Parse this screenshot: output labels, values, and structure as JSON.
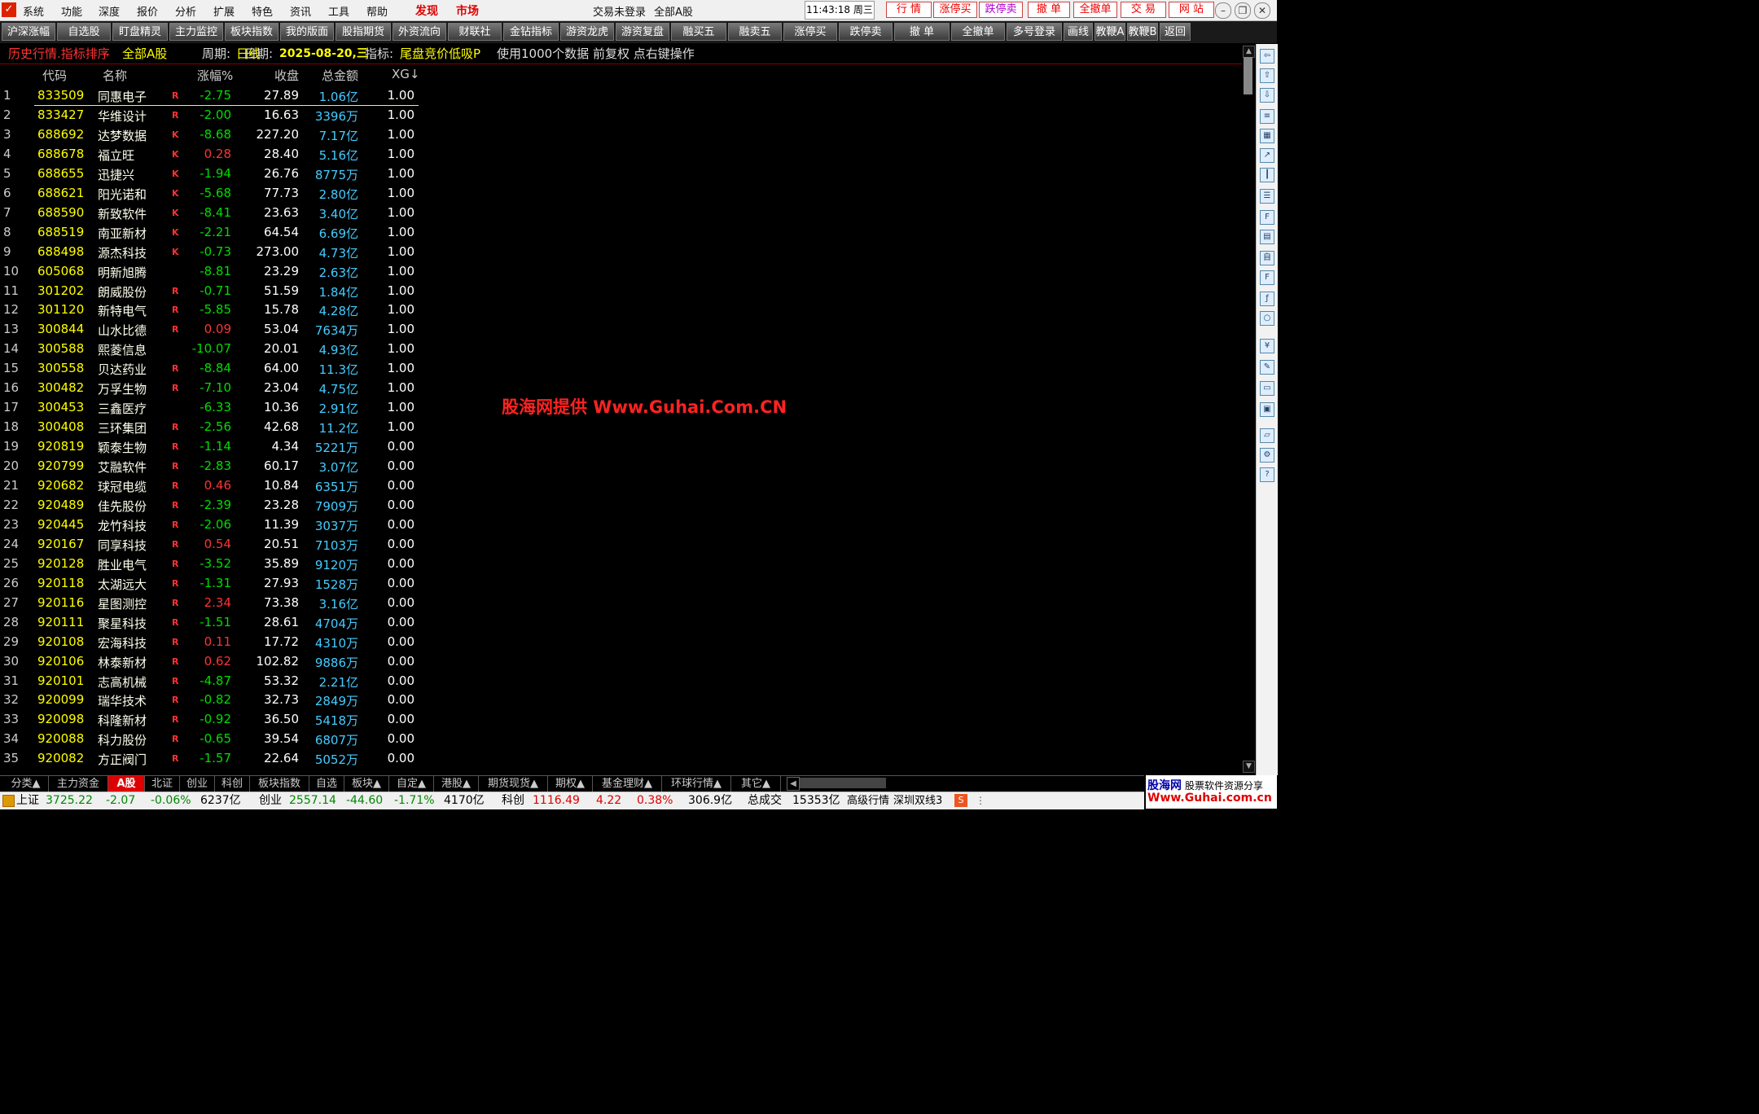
{
  "menu": {
    "items": [
      "系统",
      "功能",
      "深度",
      "报价",
      "分析",
      "扩展",
      "特色",
      "资讯",
      "工具",
      "帮助"
    ],
    "discover": "发现",
    "market": "市场",
    "login_status": "交易未登录",
    "login_scope": "全部A股",
    "clock": "11:43:18 周三",
    "quick_buttons": [
      "行 情",
      "涨停买",
      "跌停卖",
      "撤 单",
      "全撤单",
      "交 易",
      "网 站"
    ]
  },
  "toolbar": {
    "buttons": [
      "沪深涨幅",
      "自选股",
      "盯盘精灵",
      "主力监控",
      "板块指数",
      "我的版面",
      "股指期货",
      "外资流向",
      "财联社",
      "金钻指标",
      "游资龙虎",
      "游资复盘",
      "融买五",
      "融卖五",
      "涨停买",
      "跌停卖",
      "撤 单",
      "全撤单",
      "多号登录",
      "画线",
      "教鞭A",
      "教鞭B",
      "返回"
    ]
  },
  "infobar": {
    "title": "历史行情.指标排序",
    "scope": "全部A股",
    "period_label": "周期:",
    "period": "日线",
    "date_label": "日期:",
    "date": "2025-08-20,三",
    "indicator_label": "指标:",
    "indicator": "尾盘竞价低吸P",
    "note": "使用1000个数据 前复权 点右键操作"
  },
  "table": {
    "columns": [
      "代码",
      "名称",
      "涨幅%",
      "收盘",
      "总金额",
      "XG↓"
    ],
    "rows": [
      {
        "idx": "1",
        "code": "833509",
        "name": "同惠电子",
        "flag": "R",
        "chg": "-2.75",
        "close": "27.89",
        "amt": "1.06亿",
        "xg": "1.00"
      },
      {
        "idx": "2",
        "code": "833427",
        "name": "华维设计",
        "flag": "R",
        "chg": "-2.00",
        "close": "16.63",
        "amt": "3396万",
        "xg": "1.00"
      },
      {
        "idx": "3",
        "code": "688692",
        "name": "达梦数据",
        "flag": "K",
        "chg": "-8.68",
        "close": "227.20",
        "amt": "7.17亿",
        "xg": "1.00"
      },
      {
        "idx": "4",
        "code": "688678",
        "name": "福立旺",
        "flag": "K",
        "chg": "0.28",
        "close": "28.40",
        "amt": "5.16亿",
        "xg": "1.00"
      },
      {
        "idx": "5",
        "code": "688655",
        "name": "迅捷兴",
        "flag": "K",
        "chg": "-1.94",
        "close": "26.76",
        "amt": "8775万",
        "xg": "1.00"
      },
      {
        "idx": "6",
        "code": "688621",
        "name": "阳光诺和",
        "flag": "K",
        "chg": "-5.68",
        "close": "77.73",
        "amt": "2.80亿",
        "xg": "1.00"
      },
      {
        "idx": "7",
        "code": "688590",
        "name": "新致软件",
        "flag": "K",
        "chg": "-8.41",
        "close": "23.63",
        "amt": "3.40亿",
        "xg": "1.00"
      },
      {
        "idx": "8",
        "code": "688519",
        "name": "南亚新材",
        "flag": "K",
        "chg": "-2.21",
        "close": "64.54",
        "amt": "6.69亿",
        "xg": "1.00"
      },
      {
        "idx": "9",
        "code": "688498",
        "name": "源杰科技",
        "flag": "K",
        "chg": "-0.73",
        "close": "273.00",
        "amt": "4.73亿",
        "xg": "1.00"
      },
      {
        "idx": "10",
        "code": "605068",
        "name": "明新旭腾",
        "flag": "",
        "chg": "-8.81",
        "close": "23.29",
        "amt": "2.63亿",
        "xg": "1.00"
      },
      {
        "idx": "11",
        "code": "301202",
        "name": "朗威股份",
        "flag": "R",
        "chg": "-0.71",
        "close": "51.59",
        "amt": "1.84亿",
        "xg": "1.00"
      },
      {
        "idx": "12",
        "code": "301120",
        "name": "新特电气",
        "flag": "R",
        "chg": "-5.85",
        "close": "15.78",
        "amt": "4.28亿",
        "xg": "1.00"
      },
      {
        "idx": "13",
        "code": "300844",
        "name": "山水比德",
        "flag": "R",
        "chg": "0.09",
        "close": "53.04",
        "amt": "7634万",
        "xg": "1.00"
      },
      {
        "idx": "14",
        "code": "300588",
        "name": "熙菱信息",
        "flag": "",
        "chg": "-10.07",
        "close": "20.01",
        "amt": "4.93亿",
        "xg": "1.00"
      },
      {
        "idx": "15",
        "code": "300558",
        "name": "贝达药业",
        "flag": "R",
        "chg": "-8.84",
        "close": "64.00",
        "amt": "11.3亿",
        "xg": "1.00"
      },
      {
        "idx": "16",
        "code": "300482",
        "name": "万孚生物",
        "flag": "R",
        "chg": "-7.10",
        "close": "23.04",
        "amt": "4.75亿",
        "xg": "1.00"
      },
      {
        "idx": "17",
        "code": "300453",
        "name": "三鑫医疗",
        "flag": "",
        "chg": "-6.33",
        "close": "10.36",
        "amt": "2.91亿",
        "xg": "1.00"
      },
      {
        "idx": "18",
        "code": "300408",
        "name": "三环集团",
        "flag": "R",
        "chg": "-2.56",
        "close": "42.68",
        "amt": "11.2亿",
        "xg": "1.00"
      },
      {
        "idx": "19",
        "code": "920819",
        "name": "颖泰生物",
        "flag": "R",
        "chg": "-1.14",
        "close": "4.34",
        "amt": "5221万",
        "xg": "0.00"
      },
      {
        "idx": "20",
        "code": "920799",
        "name": "艾融软件",
        "flag": "R",
        "chg": "-2.83",
        "close": "60.17",
        "amt": "3.07亿",
        "xg": "0.00"
      },
      {
        "idx": "21",
        "code": "920682",
        "name": "球冠电缆",
        "flag": "R",
        "chg": "0.46",
        "close": "10.84",
        "amt": "6351万",
        "xg": "0.00"
      },
      {
        "idx": "22",
        "code": "920489",
        "name": "佳先股份",
        "flag": "R",
        "chg": "-2.39",
        "close": "23.28",
        "amt": "7909万",
        "xg": "0.00"
      },
      {
        "idx": "23",
        "code": "920445",
        "name": "龙竹科技",
        "flag": "R",
        "chg": "-2.06",
        "close": "11.39",
        "amt": "3037万",
        "xg": "0.00"
      },
      {
        "idx": "24",
        "code": "920167",
        "name": "同享科技",
        "flag": "R",
        "chg": "0.54",
        "close": "20.51",
        "amt": "7103万",
        "xg": "0.00"
      },
      {
        "idx": "25",
        "code": "920128",
        "name": "胜业电气",
        "flag": "R",
        "chg": "-3.52",
        "close": "35.89",
        "amt": "9120万",
        "xg": "0.00"
      },
      {
        "idx": "26",
        "code": "920118",
        "name": "太湖远大",
        "flag": "R",
        "chg": "-1.31",
        "close": "27.93",
        "amt": "1528万",
        "xg": "0.00"
      },
      {
        "idx": "27",
        "code": "920116",
        "name": "星图测控",
        "flag": "R",
        "chg": "2.34",
        "close": "73.38",
        "amt": "3.16亿",
        "xg": "0.00"
      },
      {
        "idx": "28",
        "code": "920111",
        "name": "聚星科技",
        "flag": "R",
        "chg": "-1.51",
        "close": "28.61",
        "amt": "4704万",
        "xg": "0.00"
      },
      {
        "idx": "29",
        "code": "920108",
        "name": "宏海科技",
        "flag": "R",
        "chg": "0.11",
        "close": "17.72",
        "amt": "4310万",
        "xg": "0.00"
      },
      {
        "idx": "30",
        "code": "920106",
        "name": "林泰新材",
        "flag": "R",
        "chg": "0.62",
        "close": "102.82",
        "amt": "9886万",
        "xg": "0.00"
      },
      {
        "idx": "31",
        "code": "920101",
        "name": "志高机械",
        "flag": "R",
        "chg": "-4.87",
        "close": "53.32",
        "amt": "2.21亿",
        "xg": "0.00"
      },
      {
        "idx": "32",
        "code": "920099",
        "name": "瑞华技术",
        "flag": "R",
        "chg": "-0.82",
        "close": "32.73",
        "amt": "2849万",
        "xg": "0.00"
      },
      {
        "idx": "33",
        "code": "920098",
        "name": "科隆新材",
        "flag": "R",
        "chg": "-0.92",
        "close": "36.50",
        "amt": "5418万",
        "xg": "0.00"
      },
      {
        "idx": "34",
        "code": "920088",
        "name": "科力股份",
        "flag": "R",
        "chg": "-0.65",
        "close": "39.54",
        "amt": "6807万",
        "xg": "0.00"
      },
      {
        "idx": "35",
        "code": "920082",
        "name": "方正阀门",
        "flag": "R",
        "chg": "-1.57",
        "close": "22.64",
        "amt": "5052万",
        "xg": "0.00"
      }
    ]
  },
  "watermark": "股海网提供 Www.Guhai.Com.CN",
  "tabs": [
    "分类▲",
    "主力资金",
    "A股",
    "北证",
    "创业",
    "科创",
    "板块指数",
    "自选",
    "板块▲",
    "自定▲",
    "港股▲",
    "期货现货▲",
    "期权▲",
    "基金理财▲",
    "环球行情▲",
    "其它▲"
  ],
  "status": {
    "sh_name": "上证",
    "sh_val": "3725.22",
    "sh_chg": "-2.07",
    "sh_pct": "-0.06%",
    "sh_amt": "6237亿",
    "cy_name": "创业",
    "cy_val": "2557.14",
    "cy_chg": "-44.60",
    "cy_pct": "-1.71%",
    "cy_amt": "4170亿",
    "kc_name": "科创",
    "kc_val": "1116.49",
    "kc_chg": "4.22",
    "kc_pct": "0.38%",
    "kc_amt": "306.9亿",
    "total_label": "总成交",
    "total": "15353亿",
    "level": "高级行情",
    "line": "深圳双线3"
  },
  "brand": {
    "line1": "股海网",
    "line1b": "股票软件资源分享",
    "line2": "Www.Guhai.com.cn"
  },
  "colors": {
    "up": "#ff3333",
    "down": "#00dd00",
    "code": "#ffff00",
    "amount": "#44ccff",
    "accent": "#dd0000"
  }
}
